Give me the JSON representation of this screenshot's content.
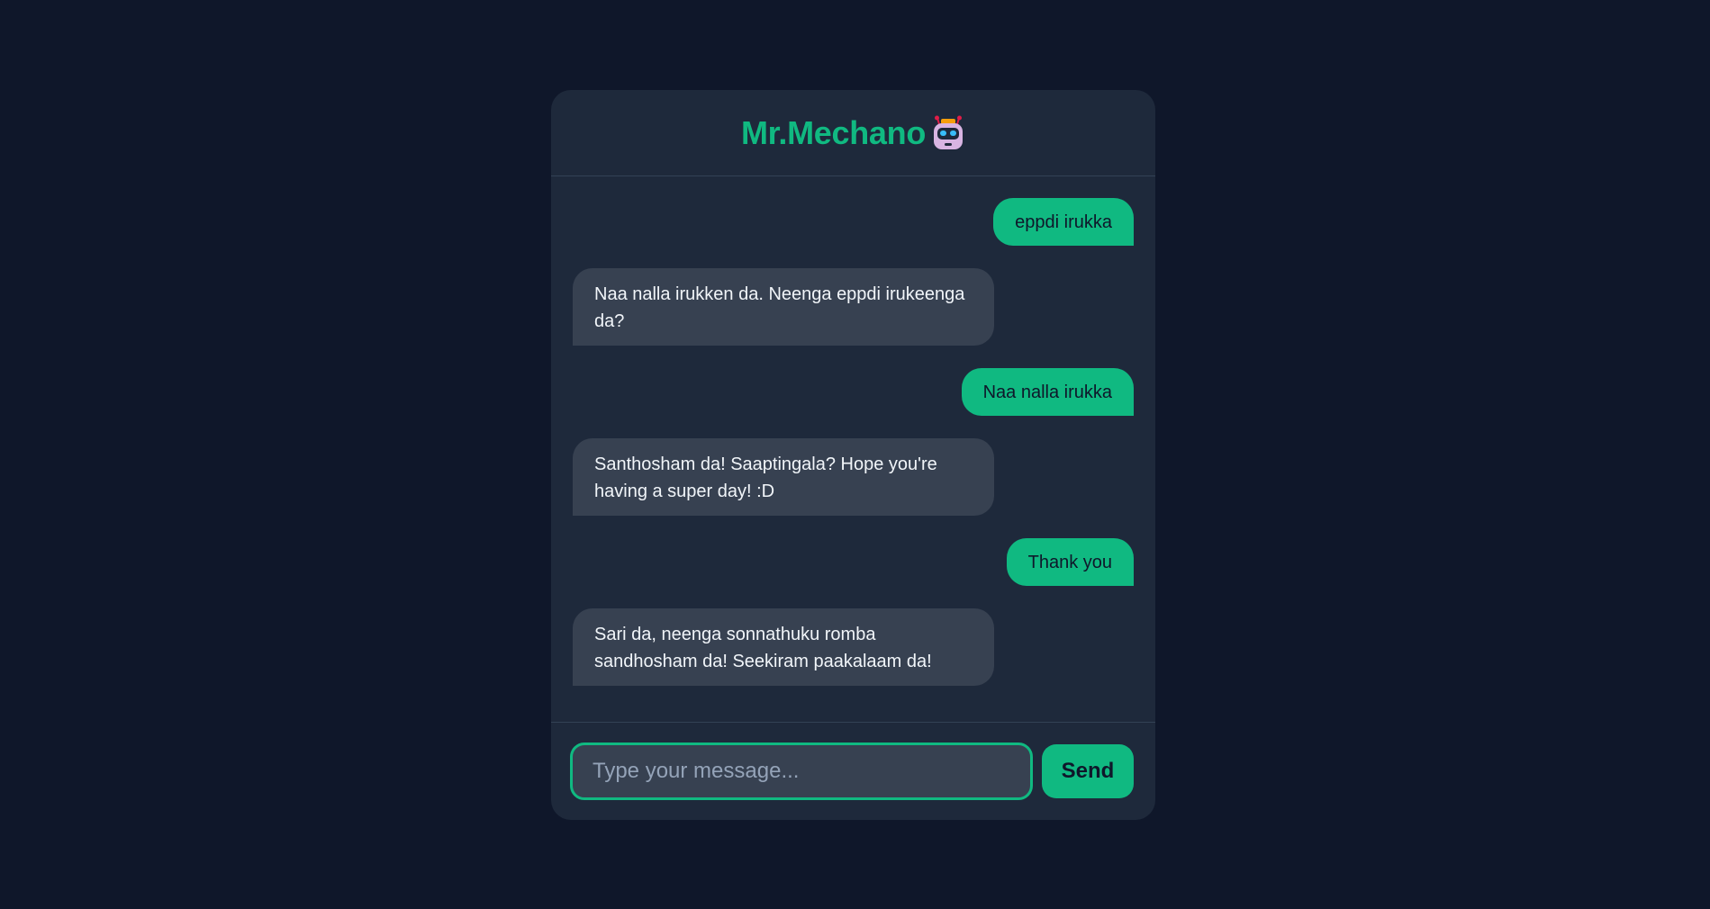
{
  "app": {
    "title": "Mr.Mechano",
    "title_icon": "robot-icon",
    "colors": {
      "background": "#0f172a",
      "card": "#1e293b",
      "accent": "#10b981",
      "bot_bubble": "#374151"
    }
  },
  "messages": [
    {
      "sender": "user",
      "text": "eppdi irukka"
    },
    {
      "sender": "bot",
      "text": "Naa nalla irukken da. Neenga eppdi irukeenga da?"
    },
    {
      "sender": "user",
      "text": "Naa nalla irukka"
    },
    {
      "sender": "bot",
      "text": "Santhosham da! Saaptingala? Hope you're having a super day! :D"
    },
    {
      "sender": "user",
      "text": "Thank you"
    },
    {
      "sender": "bot",
      "text": "Sari da, neenga sonnathuku romba sandhosham da! Seekiram paakalaam da!"
    }
  ],
  "composer": {
    "placeholder": "Type your message...",
    "value": "",
    "send_label": "Send"
  }
}
